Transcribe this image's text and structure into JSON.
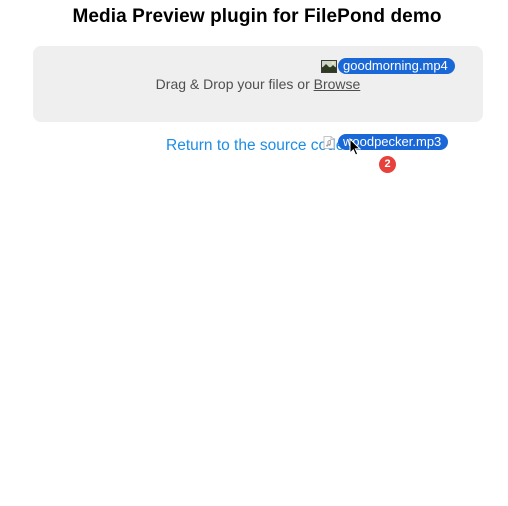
{
  "page": {
    "title": "Media Preview plugin for FilePond demo"
  },
  "dropzone": {
    "label_prefix": "Drag & Drop your files or ",
    "browse_label": "Browse"
  },
  "links": {
    "return_label": "Return to the source code"
  },
  "drag": {
    "files": [
      {
        "name": "goodmorning.mp4",
        "icon": "video-thumbnail-icon"
      },
      {
        "name": "woodpecker.mp3",
        "icon": "audio-file-icon"
      }
    ],
    "count": "2"
  },
  "colors": {
    "link": "#1d8de6",
    "pill": "#1a68d8",
    "badge": "#e8403a",
    "dropzone_bg": "#efefef"
  }
}
